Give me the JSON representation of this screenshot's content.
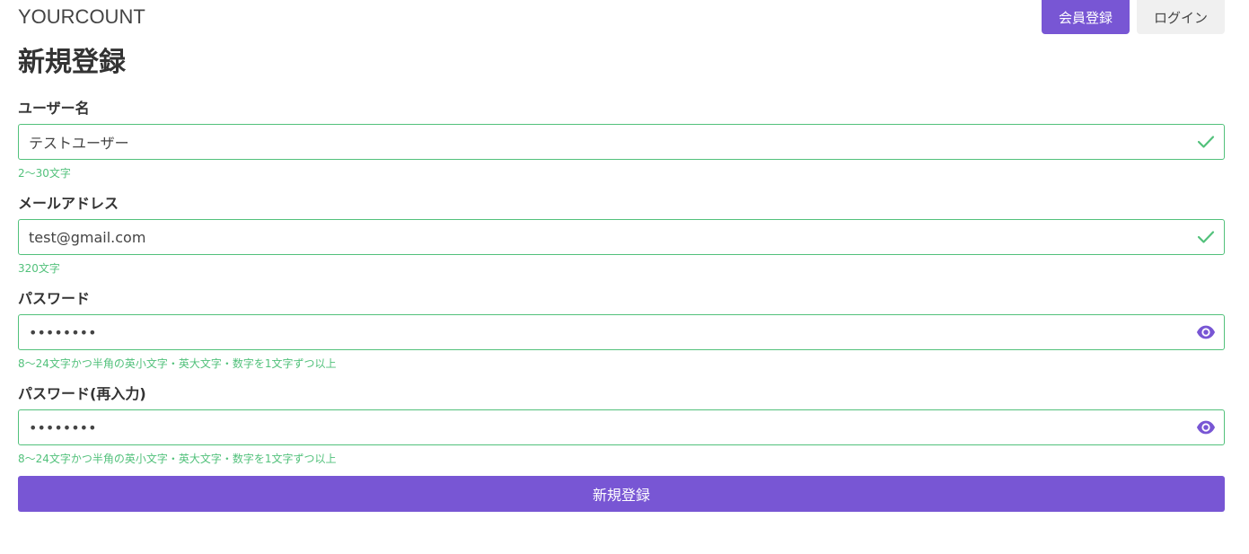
{
  "header": {
    "brand": "YOURCOUNT",
    "register_label": "会員登録",
    "login_label": "ログイン"
  },
  "page": {
    "title": "新規登録"
  },
  "form": {
    "username": {
      "label": "ユーザー名",
      "value": "テストユーザー",
      "help": "2〜30文字",
      "status_icon": "check-icon"
    },
    "email": {
      "label": "メールアドレス",
      "value": "test@gmail.com",
      "help": "320文字",
      "status_icon": "check-icon"
    },
    "password": {
      "label": "パスワード",
      "value": "••••••••",
      "help": "8〜24文字かつ半角の英小文字・英大文字・数字を1文字ずつ以上",
      "toggle_icon": "eye-icon"
    },
    "password_confirm": {
      "label": "パスワード(再入力)",
      "value": "••••••••",
      "help": "8〜24文字かつ半角の英小文字・英大文字・数字を1文字ずつ以上",
      "toggle_icon": "eye-icon"
    },
    "submit_label": "新規登録"
  },
  "colors": {
    "accent": "#7856d4",
    "valid": "#52c17b",
    "text": "#333333",
    "secondary_button": "#f0f0f0"
  }
}
